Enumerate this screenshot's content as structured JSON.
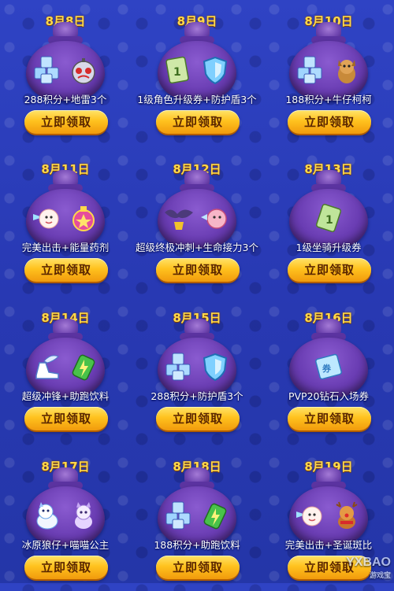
{
  "button_label": "立即领取",
  "colors": {
    "date": "#ffd94a",
    "button": "#ffc21e",
    "bag": "#6a3db3",
    "background": "#2a3dbb"
  },
  "rewards": [
    {
      "date": "8月8日",
      "label": "288积分+地雷3个",
      "icons": [
        "ice-cubes-icon",
        "bomb-icon"
      ]
    },
    {
      "date": "8月9日",
      "label": "1级角色升级券+防护盾3个",
      "icons": [
        "level-up-ticket-icon",
        "shield-icon"
      ]
    },
    {
      "date": "8月10日",
      "label": "188积分+牛仔柯柯",
      "icons": [
        "ice-cubes-icon",
        "cowboy-dog-pet-icon"
      ]
    },
    {
      "date": "8月11日",
      "label": "完美出击+能量药剂",
      "icons": [
        "perfect-strike-icon",
        "energy-potion-icon"
      ]
    },
    {
      "date": "8月12日",
      "label": "超级终极冲刺+生命接力3个",
      "icons": [
        "ultimate-sprint-icon",
        "life-relay-icon"
      ]
    },
    {
      "date": "8月13日",
      "label": "1级坐骑升级券",
      "icons": [
        "mount-level-up-ticket-icon"
      ]
    },
    {
      "date": "8月14日",
      "label": "超级冲锋+助跑饮料",
      "icons": [
        "winged-boot-icon",
        "energy-drink-icon"
      ]
    },
    {
      "date": "8月15日",
      "label": "288积分+防护盾3个",
      "icons": [
        "ice-cubes-icon",
        "shield-icon"
      ]
    },
    {
      "date": "8月16日",
      "label": "PVP20钻石入场券",
      "icons": [
        "pvp-ticket-icon"
      ]
    },
    {
      "date": "8月17日",
      "label": "冰原狼仔+喵喵公主",
      "icons": [
        "ice-wolf-pet-icon",
        "cat-princess-pet-icon"
      ]
    },
    {
      "date": "8月18日",
      "label": "188积分+助跑饮料",
      "icons": [
        "ice-cubes-icon",
        "energy-drink-icon"
      ]
    },
    {
      "date": "8月19日",
      "label": "完美出击+圣诞斑比",
      "icons": [
        "perfect-strike-icon",
        "christmas-deer-pet-icon"
      ]
    }
  ],
  "watermark": {
    "text": "YXBAO",
    "sub": "游戏宝"
  }
}
